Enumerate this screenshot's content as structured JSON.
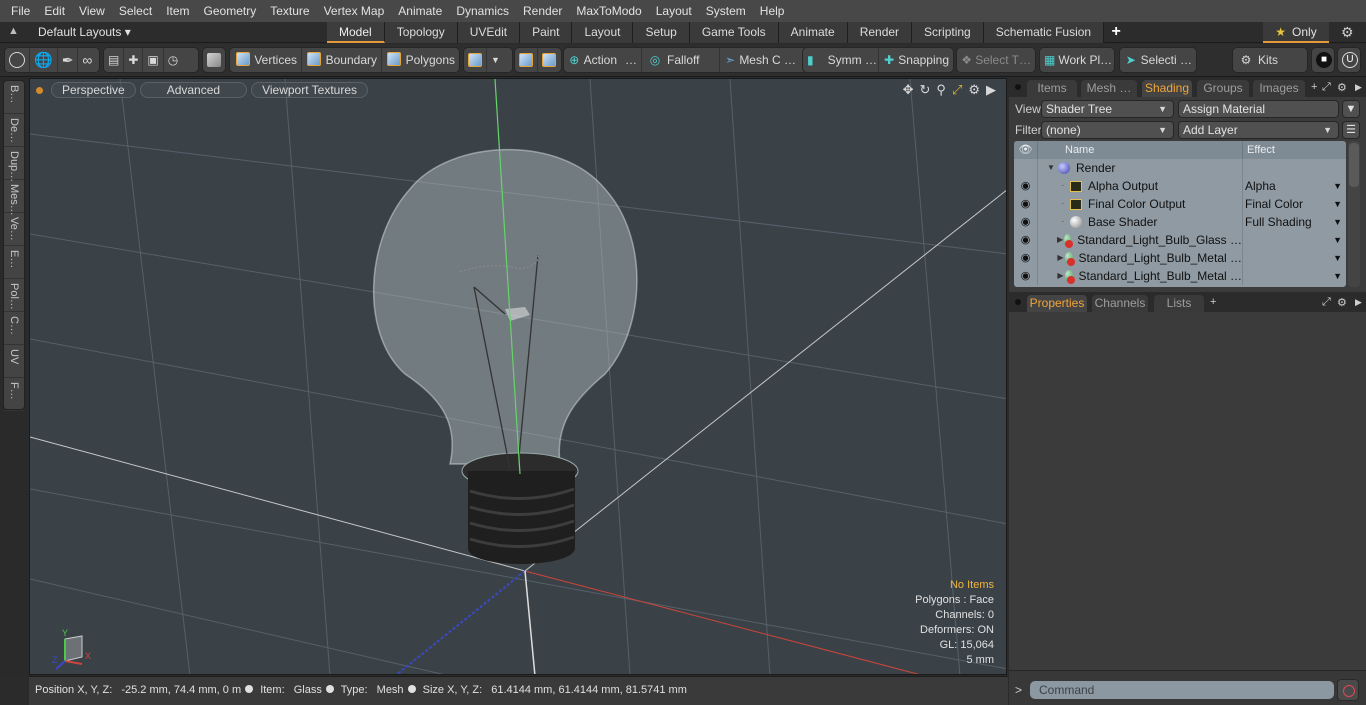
{
  "menu": [
    "File",
    "Edit",
    "View",
    "Select",
    "Item",
    "Geometry",
    "Texture",
    "Vertex Map",
    "Animate",
    "Dynamics",
    "Render",
    "MaxToModo",
    "Layout",
    "System",
    "Help"
  ],
  "layouts": {
    "name": "Default Layouts ▾",
    "tabs": [
      "Model",
      "Topology",
      "UVEdit",
      "Paint",
      "Layout",
      "Setup",
      "Game Tools",
      "Animate",
      "Render",
      "Scripting",
      "Schematic Fusion"
    ],
    "active_tab": "Model",
    "add_tab": "+",
    "only_label": "Only"
  },
  "toolbar": {
    "vertices": "Vertices",
    "boundary": "Boundary",
    "polygons": "Polygons",
    "action": "Action",
    "falloff": "Falloff",
    "mesh_constraints": "Mesh C …",
    "symmetry": "Symm …",
    "snapping": "Snapping",
    "select_through": "Select T…",
    "work_plane": "Work Pl…",
    "selection_sets": "Selecti …",
    "kits": "Kits"
  },
  "left_tabs": [
    "B…",
    "De…",
    "Dup…",
    "Mes…",
    "Ve…",
    "E…",
    "Pol…",
    "C…",
    "UV",
    "F…"
  ],
  "viewport": {
    "view_mode": "Perspective",
    "shading": "Advanced",
    "textures": "Viewport Textures",
    "info": {
      "selection": "No Items",
      "mode": "Polygons : Face",
      "channels": "Channels: 0",
      "deformers": "Deformers: ON",
      "gl": "GL: 15,064",
      "grid": "5 mm"
    },
    "axis_labels": {
      "x": "X",
      "y": "Y",
      "z": "Z"
    }
  },
  "status": {
    "position_label": "Position X, Y, Z:",
    "position_value": "-25.2 mm, 74.4 mm, 0 m",
    "item_label": "Item:",
    "item_value": "Glass",
    "type_label": "Type:",
    "type_value": "Mesh",
    "size_label": "Size X, Y, Z:",
    "size_value": "61.4144 mm, 61.4144 mm, 81.5741 mm"
  },
  "right_panel": {
    "tabs": [
      "Items",
      "Mesh …",
      "Shading",
      "Groups",
      "Images"
    ],
    "active_tab": "Shading",
    "view_label": "View",
    "view_value": "Shader Tree",
    "assign_material": "Assign Material",
    "filter_label": "Filter",
    "filter_value": "(none)",
    "add_layer": "Add Layer",
    "tree_headers": {
      "name": "Name",
      "effect": "Effect"
    },
    "tree_rows": [
      {
        "name": "Render",
        "effect": "",
        "icon": "render-sphere",
        "level": 0
      },
      {
        "name": "Alpha Output",
        "effect": "Alpha",
        "icon": "image",
        "level": 1
      },
      {
        "name": "Final Color Output",
        "effect": "Final Color",
        "icon": "image",
        "level": 1
      },
      {
        "name": "Base Shader",
        "effect": "Full Shading",
        "icon": "shader-sphere",
        "level": 1
      },
      {
        "name": "Standard_Light_Bulb_Glass …",
        "effect": "",
        "icon": "material",
        "level": 1
      },
      {
        "name": "Standard_Light_Bulb_Metal …",
        "effect": "",
        "icon": "material",
        "level": 1
      },
      {
        "name": "Standard_Light_Bulb_Metal …",
        "effect": "",
        "icon": "material",
        "level": 1
      }
    ],
    "lower_tabs": [
      "Properties",
      "Channels",
      "Lists"
    ],
    "lower_active_tab": "Properties",
    "command_prompt": ">",
    "command_placeholder": "Command"
  },
  "colors": {
    "accent": "#e49a3a",
    "viewport_bg": "#3a4248",
    "grid_line": "#5b6469",
    "x_axis": "#d0443a",
    "y_axis": "#66d46a",
    "z_axis": "#3a48c8"
  }
}
